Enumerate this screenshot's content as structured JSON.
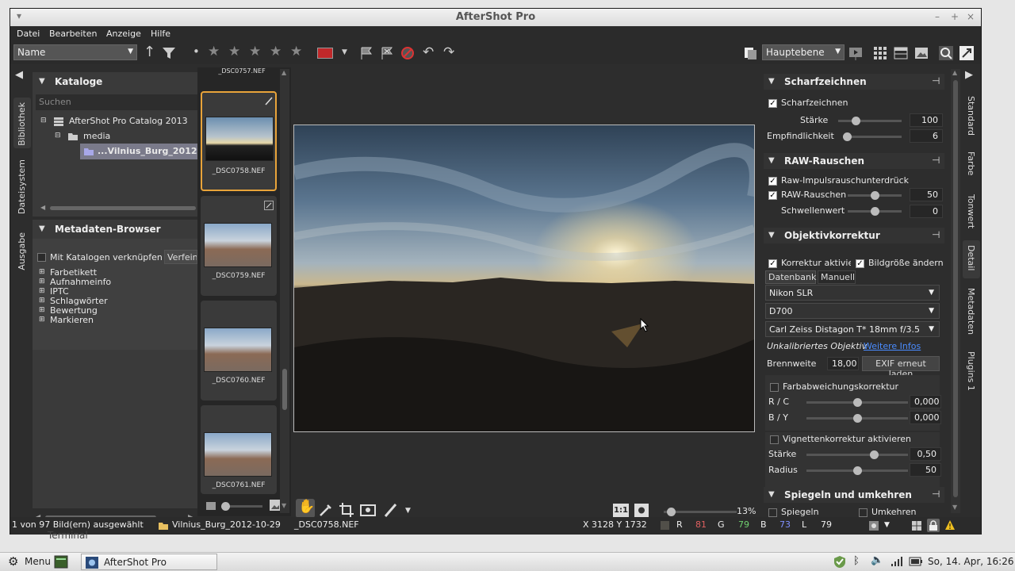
{
  "window": {
    "title": "AfterShot Pro"
  },
  "menu": [
    "Datei",
    "Bearbeiten",
    "Anzeige",
    "Hilfe"
  ],
  "toolbar": {
    "sort_value": "Name",
    "layer_value": "Hauptebene",
    "rating_dot": "•"
  },
  "left_tabs": [
    "Bibliothek",
    "Dateisystem",
    "Ausgabe"
  ],
  "catalogs": {
    "title": "Kataloge",
    "search_placeholder": "Suchen",
    "tree": [
      "AfterShot Pro Catalog 2013",
      "media",
      "...Vilnius_Burg_2012-"
    ]
  },
  "metadata_browser": {
    "title": "Metadaten-Browser",
    "link_label": "Mit Katalogen verknüpfen",
    "refine_button": "Verfein",
    "items": [
      "Farbetikett",
      "Aufnahmeinfo",
      "IPTC",
      "Schlagwörter",
      "Bewertung",
      "Markieren"
    ]
  },
  "filmstrip": {
    "top_partial": "_DSC0757.NEF",
    "items": [
      "_DSC0758.NEF",
      "_DSC0759.NEF",
      "_DSC0760.NEF",
      "_DSC0761.NEF"
    ]
  },
  "zoom": {
    "value": "13%",
    "one_to_one": "1:1"
  },
  "right_tabs": [
    "Standard",
    "Farbe",
    "Tonwert",
    "Detail",
    "Metadaten",
    "Plugins 1"
  ],
  "sharpen": {
    "title": "Scharfzeichnen",
    "enable_label": "Scharfzeichnen",
    "strength_label": "Stärke",
    "strength_value": "100",
    "strength_level": 0.25,
    "sensitivity_label": "Empfindlichkeit",
    "sensitivity_value": "6",
    "sensitivity_level": 0.0
  },
  "raw_noise": {
    "title": "RAW-Rauschen",
    "impulse_label": "Raw-Impulsrauschunterdrück",
    "noise_label": "RAW-Rauschen",
    "noise_value": "50",
    "noise_level": 0.5,
    "threshold_label": "Schwellenwert",
    "threshold_value": "0",
    "threshold_level": 0.5
  },
  "lens": {
    "title": "Objektivkorrektur",
    "enable_label": "Korrektur aktivier",
    "resize_label": "Bildgröße ändern",
    "tab_database": "Datenbank",
    "tab_manual": "Manuell",
    "maker": "Nikon SLR",
    "camera": "D700",
    "lens_name": "Carl Zeiss Distagon T* 18mm f/3.5",
    "uncalibrated": "Unkalibriertes Objektiv",
    "more_info": "Weitere Infos",
    "focal_label": "Brennweite",
    "focal_value": "18,00",
    "exif_button": "EXIF erneut laden",
    "ca_label": "Farbabweichungskorrektur",
    "rc_label": "R / C",
    "rc_value": "0,000",
    "rc_level": 0.5,
    "by_label": "B / Y",
    "by_value": "0,000",
    "by_level": 0.5,
    "vignette_label": "Vignettenkorrektur aktivieren",
    "v_strength_label": "Stärke",
    "v_strength_value": "0,50",
    "v_strength_level": 0.68,
    "v_radius_label": "Radius",
    "v_radius_value": "50",
    "v_radius_level": 0.5
  },
  "mirror": {
    "title": "Spiegeln und umkehren",
    "mirror_label": "Spiegeln",
    "invert_label": "Umkehren"
  },
  "status": {
    "selected": "1 von 97 Bild(ern) ausgewählt",
    "folder": "Vilnius_Burg_2012-10-29",
    "file": "_DSC0758.NEF",
    "coords": "X 3128  Y 1732",
    "r_label": "R",
    "r_value": "81",
    "g_label": "G",
    "g_value": "79",
    "b_label": "B",
    "b_value": "73",
    "l_label": "L",
    "l_value": "79"
  },
  "taskbar": {
    "menu_label": "Menu",
    "app_label": "AfterShot Pro",
    "clock": "So, 14. Apr, 16:26",
    "hidden_text": "Terminal"
  },
  "colors": {
    "accent_selection": "#e8a33a",
    "link": "#4a8cff",
    "label_red": "#c0282a"
  }
}
